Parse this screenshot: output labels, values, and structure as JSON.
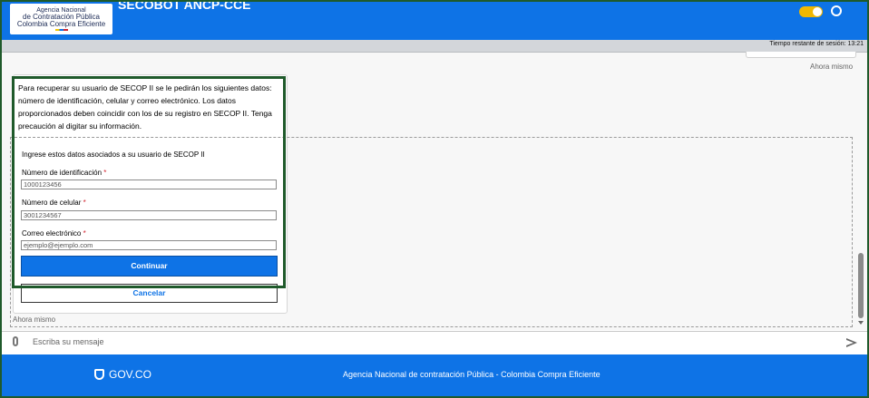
{
  "header": {
    "logo_line1": "Agencia Nacional",
    "logo_line2": "de Contratación Pública",
    "logo_line3": "Colombia Compra Eficiente",
    "bot_title": "SECOBOT ANCP-CCE"
  },
  "session": {
    "text": "Tiempo restante de sesión: 13:21"
  },
  "chat": {
    "timestamp_top": "Ahora mismo",
    "intro": "Para recuperar su usuario de SECOP II se le pedirán los siguientes datos: número de identificación, celular y correo electrónico. Los datos proporcionados deben coincidir con los de su registro en SECOP II. Tenga precaución al digitar su información.",
    "form": {
      "heading": "Ingrese estos datos asociados a su usuario de SECOP II",
      "id_label": "Número de identificación",
      "id_placeholder": "1000123456",
      "phone_label": "Número de celular",
      "phone_placeholder": "3001234567",
      "email_label": "Correo electrónico",
      "email_placeholder": "ejemplo@ejemplo.com",
      "required_mark": "*",
      "continue_label": "Continuar",
      "cancel_label": "Cancelar"
    },
    "timestamp_bottom": "Ahora mismo"
  },
  "composer": {
    "placeholder": "Escriba su mensaje"
  },
  "footer": {
    "gov_label": "GOV.CO",
    "text": "Agencia Nacional de contratación Pública - Colombia Compra Eficiente"
  },
  "colors": {
    "primary": "#0e73e6",
    "highlight_border": "#1f5a2b",
    "required": "#d1242f",
    "toggle": "#f2b800"
  },
  "icons": [
    "attach-icon",
    "send-icon",
    "toggle-switch",
    "gov-shield-icon",
    "user-icon"
  ]
}
